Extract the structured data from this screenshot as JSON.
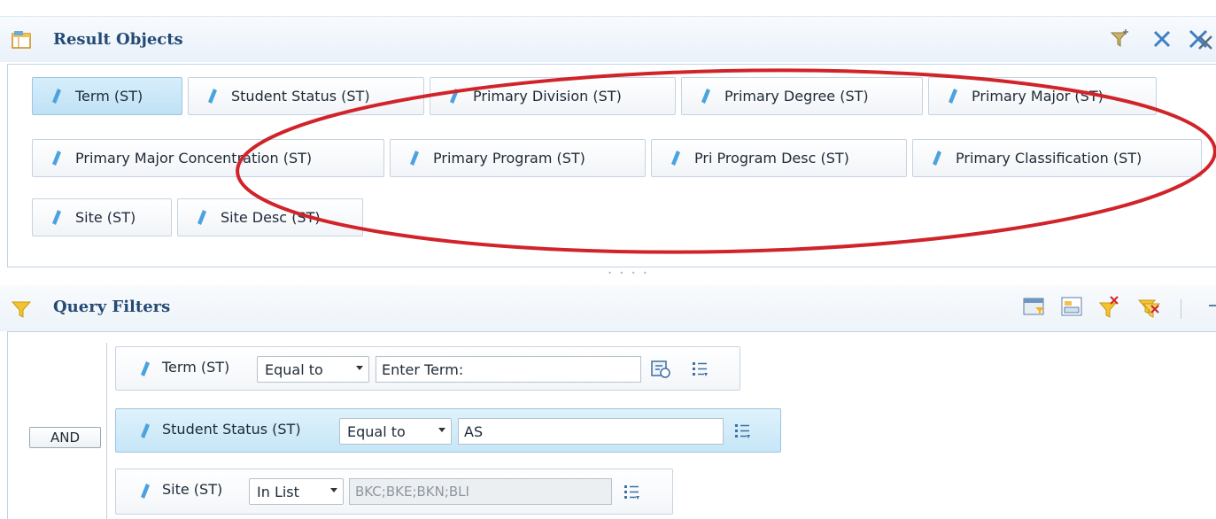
{
  "result_objects": {
    "title": "Result Objects",
    "chips": [
      {
        "label": "Term (ST)",
        "selected": true
      },
      {
        "label": "Student Status (ST)",
        "selected": false
      },
      {
        "label": "Primary Division (ST)",
        "selected": false
      },
      {
        "label": "Primary Degree (ST)",
        "selected": false
      },
      {
        "label": "Primary Major (ST)",
        "selected": false
      },
      {
        "label": "Primary Major Concentration (ST)",
        "selected": false
      },
      {
        "label": "Primary Program (ST)",
        "selected": false
      },
      {
        "label": "Pri Program Desc (ST)",
        "selected": false
      },
      {
        "label": "Primary Classification (ST)",
        "selected": false
      },
      {
        "label": "Site (ST)",
        "selected": false
      },
      {
        "label": "Site Desc (ST)",
        "selected": false
      }
    ],
    "toolbar_icons": [
      "add-filter-icon",
      "remove-icon",
      "remove-all-icon"
    ]
  },
  "query_filters": {
    "title": "Query Filters",
    "operator": "AND",
    "toolbar_icons": [
      "add-predefined-filter-icon",
      "add-subquery-icon",
      "add-ranking-icon",
      "remove-filter-icon"
    ],
    "rows": [
      {
        "object": "Term (ST)",
        "operator": "Equal to",
        "value": "Enter Term:",
        "has_prompt_icon": true,
        "selected": false
      },
      {
        "object": "Student Status (ST)",
        "operator": "Equal to",
        "value": "AS",
        "has_prompt_icon": false,
        "selected": true
      },
      {
        "object": "Site (ST)",
        "operator": "In List",
        "value": "BKC;BKE;BKN;BLI",
        "disabled": true,
        "selected": false
      }
    ]
  },
  "colors": {
    "title": "#254a74",
    "selected_bg": "#c6e6f7",
    "annotation_ellipse": "#d0232a",
    "dimension_icon": "#4aa3df"
  }
}
